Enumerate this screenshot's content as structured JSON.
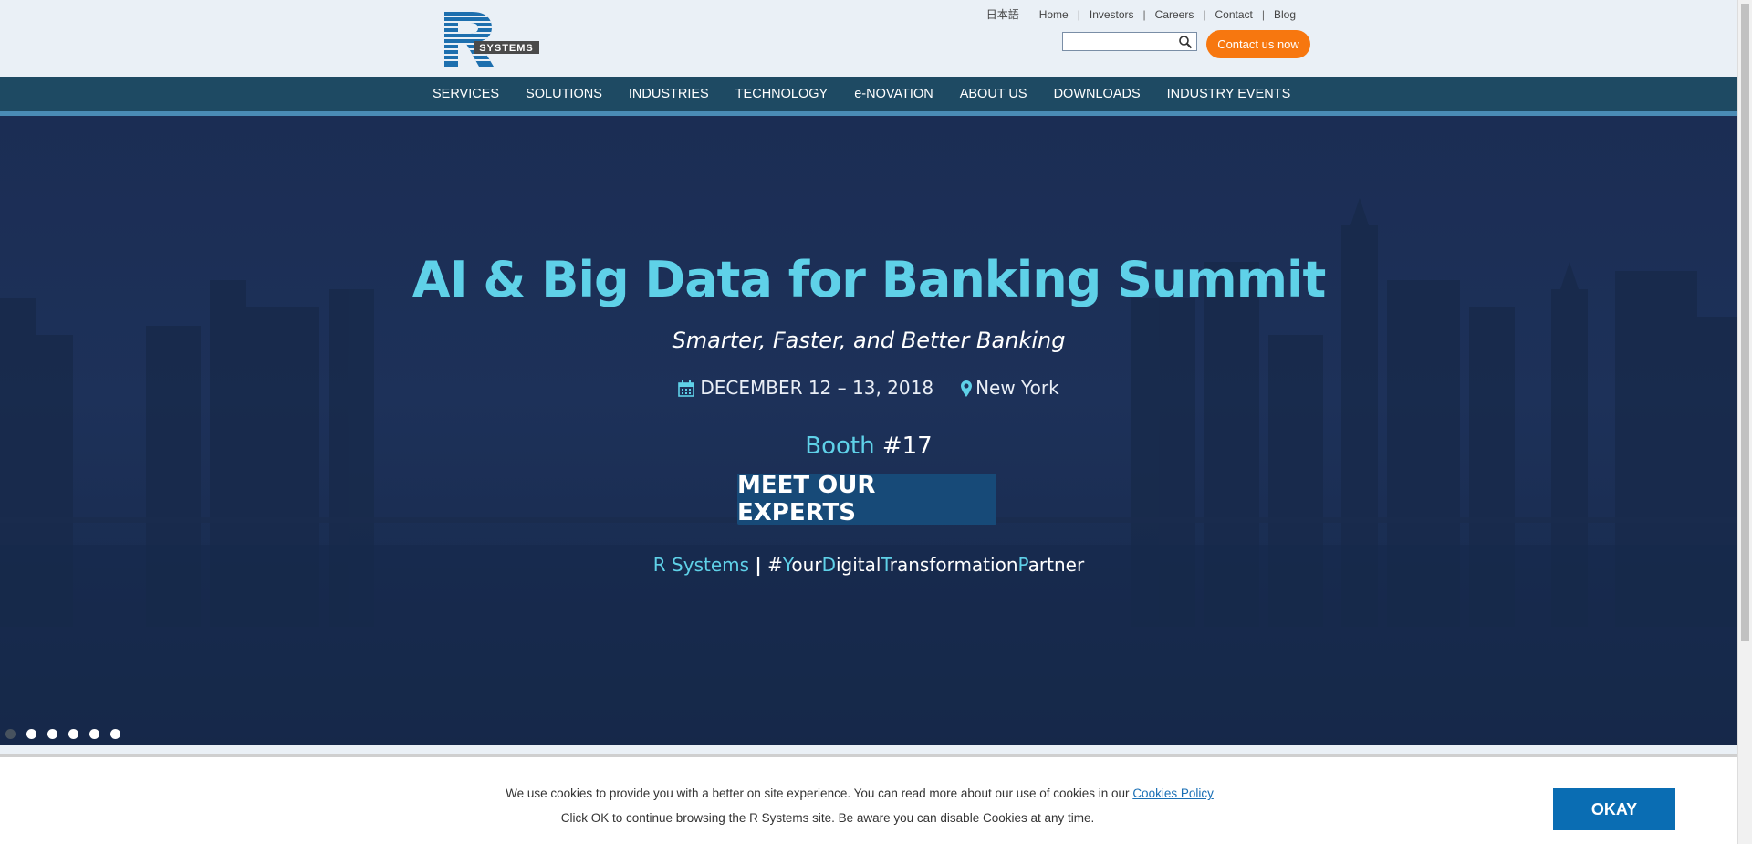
{
  "header": {
    "language_link": "日本語",
    "top_links": [
      "Home",
      "Investors",
      "Careers",
      "Contact",
      "Blog"
    ],
    "separator": "|",
    "search": {
      "value": "",
      "placeholder": ""
    },
    "contact_button": "Contact us now",
    "logo_text": "SYSTEMS"
  },
  "nav": {
    "items": [
      "SERVICES",
      "SOLUTIONS",
      "INDUSTRIES",
      "TECHNOLOGY",
      "e-NOVATION",
      "ABOUT US",
      "DOWNLOADS",
      "INDUSTRY EVENTS"
    ]
  },
  "hero": {
    "title": "AI & Big Data for Banking Summit",
    "subtitle": "Smarter, Faster, and Better Banking",
    "date": "DECEMBER 12 – 13, 2018",
    "location": "New York",
    "booth_label": "Booth",
    "booth_number": "#17",
    "cta": "MEET OUR EXPERTS",
    "tagline_brand": "R Systems",
    "tagline_sep": "|",
    "tagline_hash": "#",
    "tagline_parts": [
      "Y",
      "our",
      "D",
      "igital",
      "T",
      "ransformation",
      "P",
      "artner"
    ],
    "slides_total": 6,
    "active_slide": 1
  },
  "cookie": {
    "line1": "We use cookies to provide you with a better on site experience. You can read more about our use of cookies in our",
    "link": "Cookies Policy",
    "line2": "Click OK to continue browsing the R Systems site. Be aware you can disable Cookies at any time.",
    "ok_button": "OKAY"
  },
  "colors": {
    "accent_cyan": "#5fd1e8",
    "nav_bg": "#1e4a63",
    "contact_orange": "#f7770f",
    "cta_blue": "#174a78",
    "okay_blue": "#0a6db3"
  }
}
